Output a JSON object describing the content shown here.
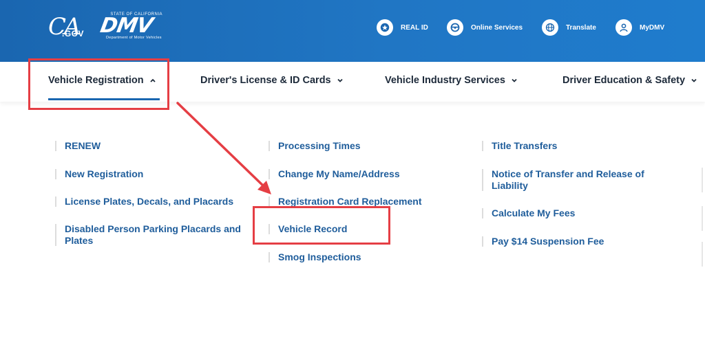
{
  "header": {
    "cagov_logo": {
      "ca": "CA",
      "gov": ".GOV"
    },
    "dmv_logo": {
      "state": "STATE OF CALIFORNIA",
      "word": "DMV",
      "dept": "Department of Motor Vehicles"
    },
    "utility_links": [
      {
        "label": "REAL ID",
        "icon": "star-icon"
      },
      {
        "label": "Online Services",
        "icon": "steering-wheel-icon"
      },
      {
        "label": "Translate",
        "icon": "globe-icon"
      },
      {
        "label": "MyDMV",
        "icon": "user-icon"
      }
    ]
  },
  "nav": {
    "items": [
      {
        "label": "Vehicle Registration",
        "expanded": true
      },
      {
        "label": "Driver's License & ID Cards",
        "expanded": false
      },
      {
        "label": "Vehicle Industry Services",
        "expanded": false
      },
      {
        "label": "Driver Education & Safety",
        "expanded": false
      }
    ]
  },
  "menu": {
    "columns": [
      [
        "RENEW",
        "New Registration",
        "License Plates, Decals, and Placards",
        "Disabled Person Parking Placards and Plates"
      ],
      [
        "Processing Times",
        "Change My Name/Address",
        "Registration Card Replacement",
        "Vehicle Record",
        "Smog Inspections"
      ],
      [
        "Title Transfers",
        "Notice of Transfer and Release of Liability",
        "Calculate My Fees",
        "Pay $14 Suspension Fee"
      ]
    ]
  },
  "colors": {
    "header_blue": "#1a66b0",
    "link_blue": "#1f5d9b",
    "annotation_red": "#e53e44"
  }
}
